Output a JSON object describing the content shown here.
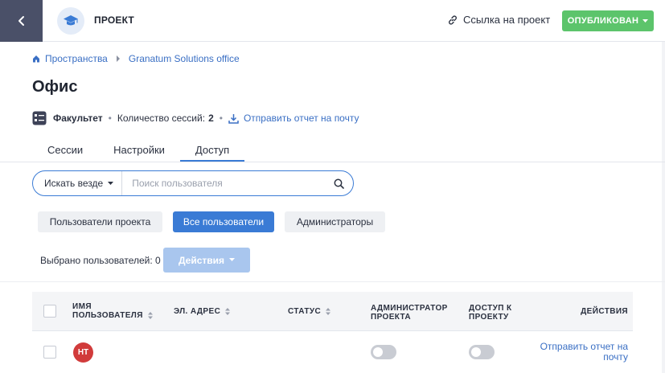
{
  "header": {
    "project_label": "ПРОЕКТ",
    "project_link": "Ссылка на проект",
    "publish_label": "ОПУБЛИКОВАН"
  },
  "breadcrumb": {
    "items": [
      "Пространства",
      "Granatum Solutions office"
    ]
  },
  "page": {
    "title": "Офис",
    "faculty": "Факультет",
    "sessions_label": "Количество сессий:",
    "sessions_count": "2",
    "send_report": "Отправить отчет на почту"
  },
  "tabs": [
    {
      "label": "Сессии",
      "active": false
    },
    {
      "label": "Настройки",
      "active": false
    },
    {
      "label": "Доступ",
      "active": true
    }
  ],
  "search": {
    "scope": "Искать везде",
    "placeholder": "Поиск пользователя"
  },
  "filters": [
    {
      "label": "Пользователи проекта",
      "active": false
    },
    {
      "label": "Все пользователи",
      "active": true
    },
    {
      "label": "Администраторы",
      "active": false
    }
  ],
  "selection": {
    "label": "Выбрано пользователей:",
    "count": "0",
    "actions_label": "Действия"
  },
  "table": {
    "columns": {
      "name": "ИМЯ ПОЛЬЗОВАТЕЛЯ",
      "email": "ЭЛ. АДРЕС",
      "status": "СТАТУС",
      "admin": "АДМИНИСТРАТОР ПРОЕКТА",
      "access": "ДОСТУП К ПРОЕКТУ",
      "actions": "ДЕЙСТВИЯ"
    },
    "rows": [
      {
        "initials": "HT",
        "admin": false,
        "access": false,
        "action": "Отправить отчет на почту"
      }
    ]
  },
  "colors": {
    "accent": "#3a7bd5",
    "published": "#5cc46b",
    "back_button": "#4a5068",
    "avatar": "#d13b3b"
  }
}
